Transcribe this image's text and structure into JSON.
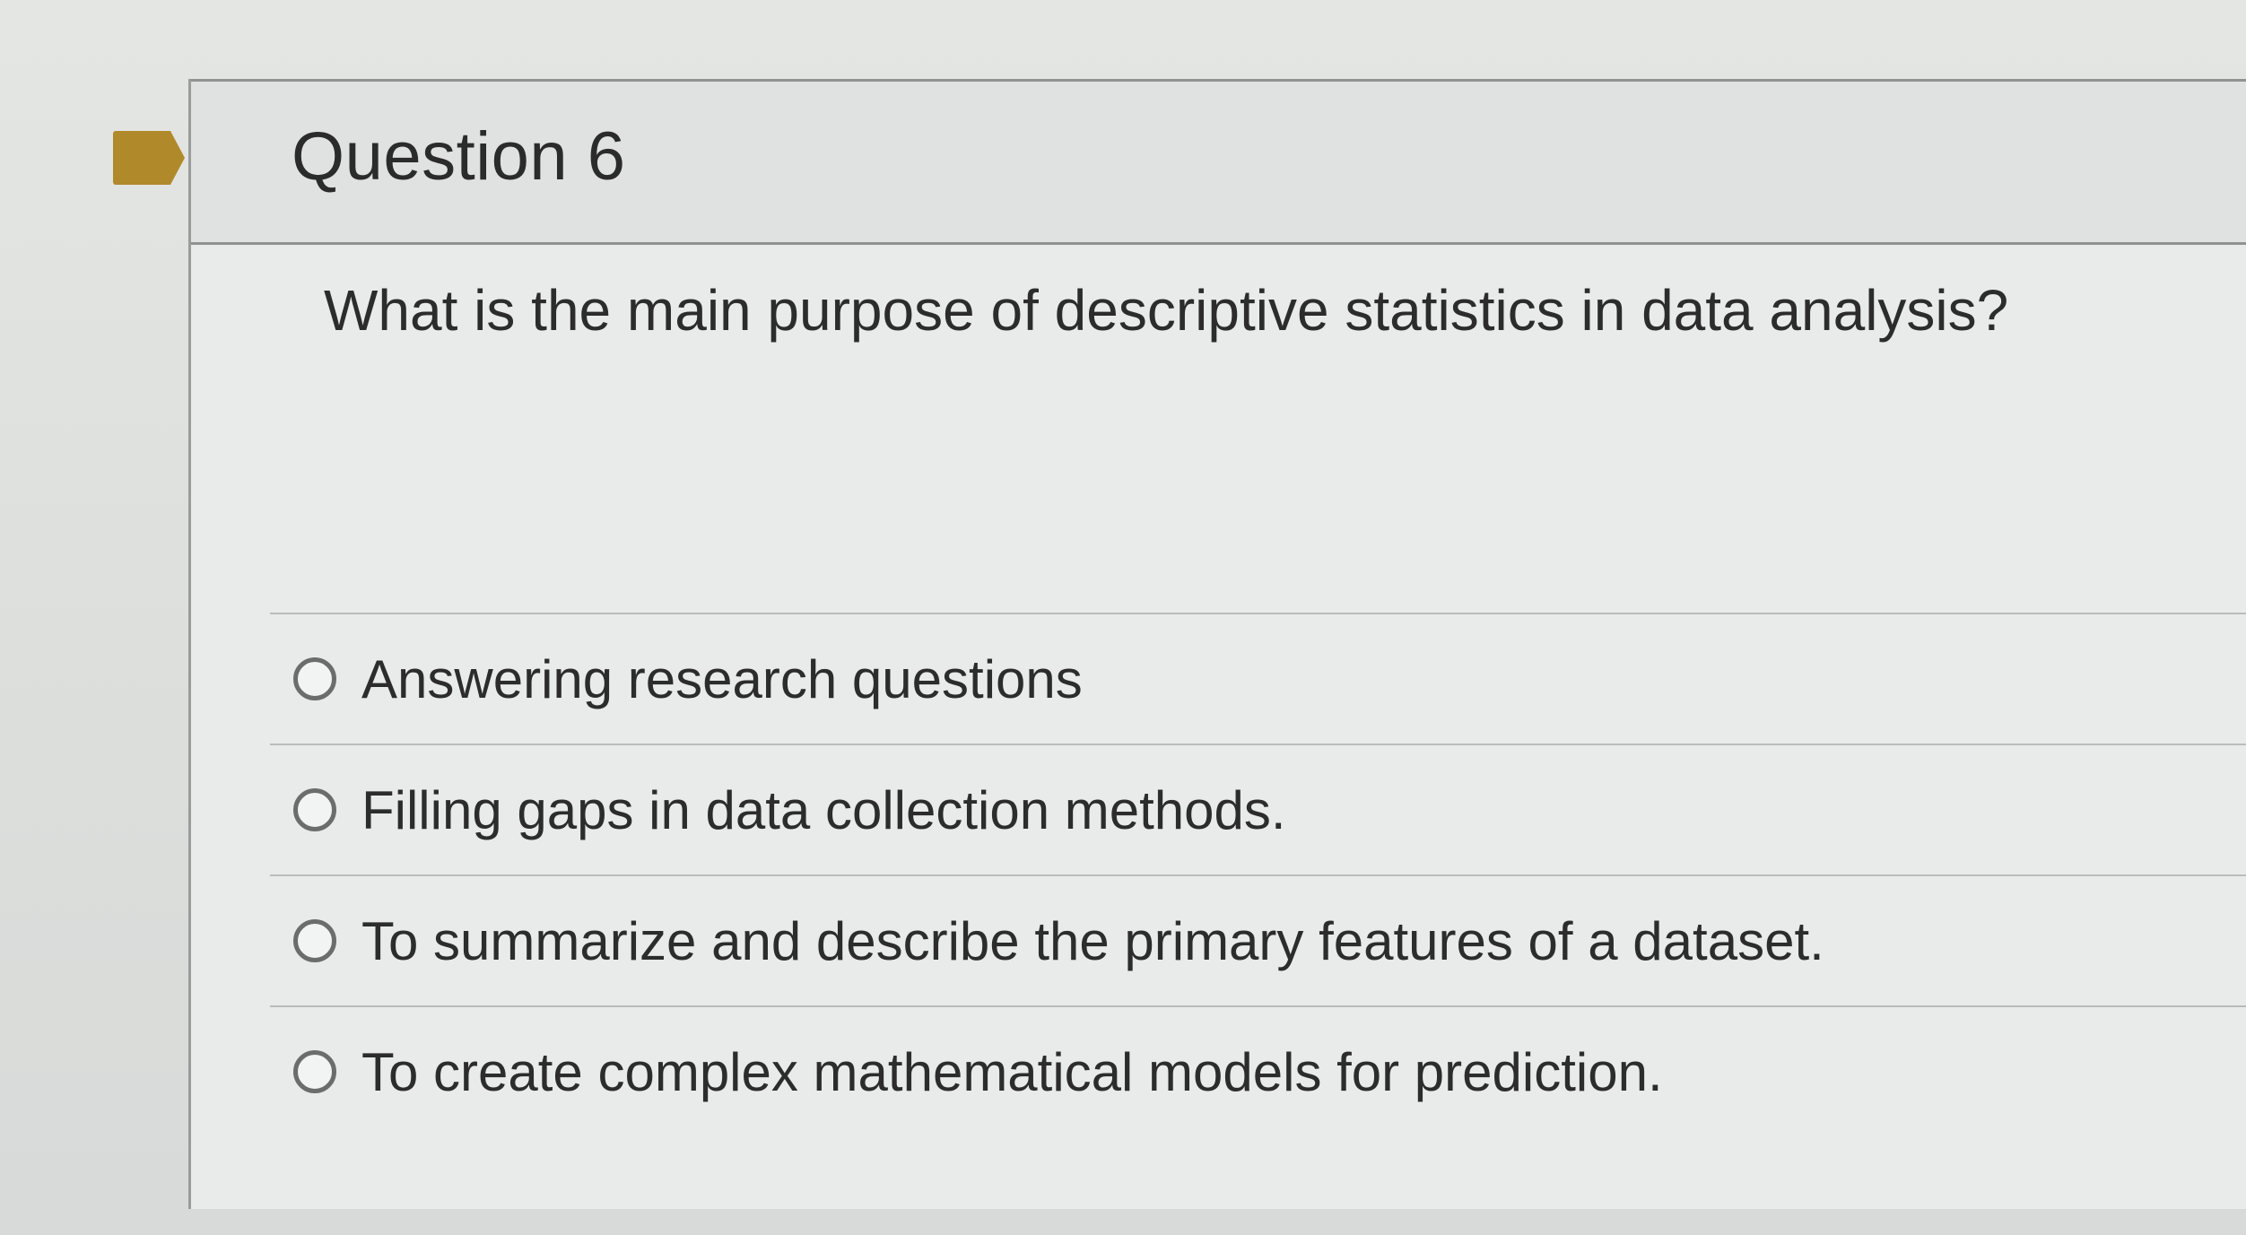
{
  "question": {
    "title": "Question 6",
    "text": "What is the main purpose of descriptive statistics in data analysis?",
    "flag_color": "#b08a2a",
    "answers": [
      {
        "label": "Answering research questions",
        "selected": false
      },
      {
        "label": "Filling gaps in data collection methods.",
        "selected": false
      },
      {
        "label": "To summarize and describe the primary features of a dataset.",
        "selected": false
      },
      {
        "label": "To create complex mathematical models for prediction.",
        "selected": false
      }
    ]
  }
}
